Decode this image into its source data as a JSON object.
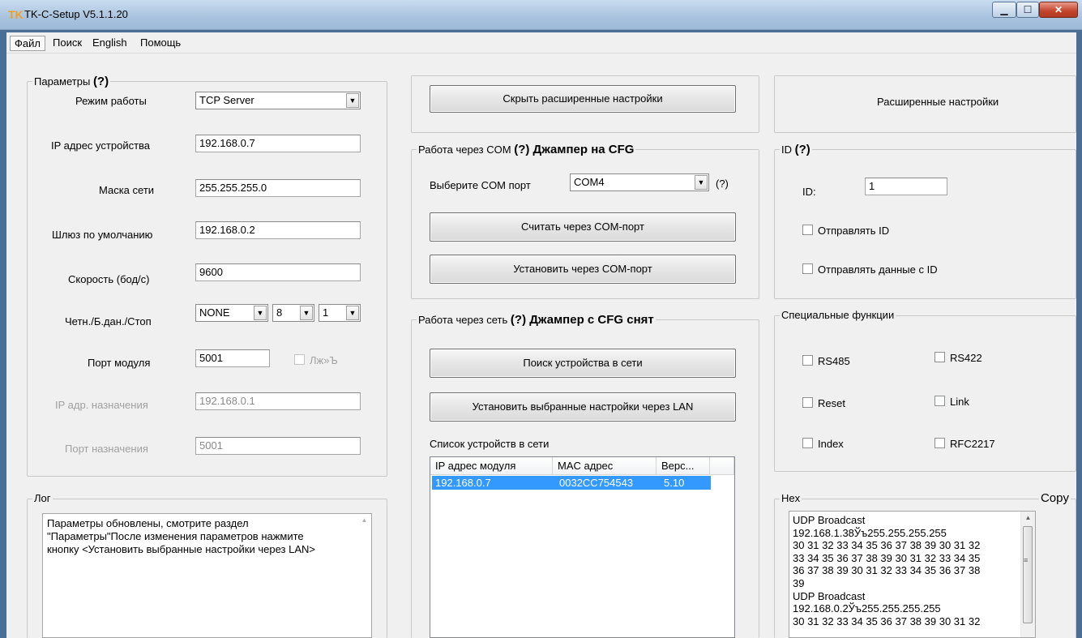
{
  "window": {
    "title": "TK-C-Setup V5.1.1.20",
    "icon_text": "TK",
    "icon_color": "#f0a020"
  },
  "menu": [
    "Файл",
    "Поиск",
    "English",
    "Помощь"
  ],
  "params": {
    "title": "Параметры",
    "help": "(?)",
    "mode_label": "Режим работы",
    "mode_value": "TCP Server",
    "ip_label": "IP адрес устройства",
    "ip_value": "192.168.0.7",
    "mask_label": "Маска сети",
    "mask_value": "255.255.255.0",
    "gateway_label": "Шлюз по умолчанию",
    "gateway_value": "192.168.0.2",
    "speed_label": "Скорость (бод/с)",
    "speed_value": "9600",
    "parity_label": "Четн./Б.дан./Стоп",
    "parity_value": "NONE",
    "databits_value": "8",
    "stopbits_value": "1",
    "port_label": "Порт модуля",
    "port_value": "5001",
    "port_check_label": "Лж»Ъ",
    "dest_ip_label": "IP адр. назначения",
    "dest_ip_value": "192.168.0.1",
    "dest_port_label": "Порт назначения",
    "dest_port_value": "5001"
  },
  "hide_advanced_label": "Скрыть расширенные настройки",
  "advanced_label": "Расширенные настройки",
  "com": {
    "title": "Работа через COM",
    "title_bold": "(?) Джампер на CFG",
    "select_label": "Выберите COM порт",
    "port_value": "COM4",
    "help": "(?)",
    "read_label": "Считать через COM-порт",
    "set_label": "Установить через COM-порт"
  },
  "id_group": {
    "title": "ID",
    "help": "(?)",
    "id_label": "ID:",
    "id_value": "1",
    "send_id_label": "Отправлять ID",
    "send_data_id_label": "Отправлять данные с ID"
  },
  "net": {
    "title": "Работа через сеть",
    "title_bold": "(?) Джампер с CFG снят",
    "search_label": "Поиск устройства в сети",
    "set_lan_label": "Установить выбранные настройки через LAN",
    "list_label": "Список устройств в сети",
    "columns": [
      "IP адрес модуля",
      "MAC адрес",
      "Верс..."
    ],
    "rows": [
      [
        "192.168.0.7",
        "0032CC754543",
        "5.10"
      ]
    ]
  },
  "special": {
    "title": "Специальные функции",
    "rs485": "RS485",
    "rs422": "RS422",
    "reset": "Reset",
    "link": "Link",
    "index": "Index",
    "rfc2217": "RFC2217"
  },
  "log": {
    "title": "Лог",
    "text": "Параметры обновлены, смотрите раздел\n\"Параметры\"После изменения параметров нажмите\nкнопку <Установить выбранные настройки через LAN>"
  },
  "hex": {
    "title": "Hex",
    "copy_label": "Copy",
    "text": "UDP Broadcast\n192.168.1.38Ўъ255.255.255.255\n30 31 32 33 34 35 36 37 38 39 30 31 32\n33 34 35 36 37 38 39 30 31 32 33 34 35\n36 37 38 39 30 31 32 33 34 35 36 37 38\n39\nUDP Broadcast\n192.168.0.2Ўъ255.255.255.255\n30 31 32 33 34 35 36 37 38 39 30 31 32"
  }
}
